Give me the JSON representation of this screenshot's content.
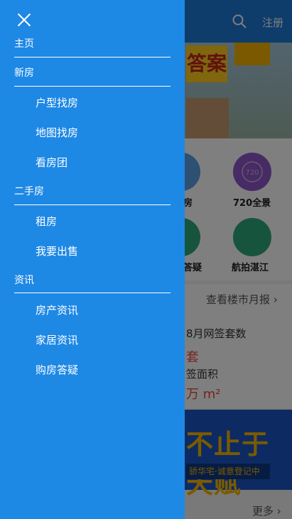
{
  "header": {
    "register_label": "注册",
    "search_icon": "search-icon"
  },
  "banner": {
    "sign_text": "答案"
  },
  "grid": {
    "items": [
      {
        "label": "房"
      },
      {
        "label": "720全景",
        "icon_text": "720"
      },
      {
        "label": "答疑"
      },
      {
        "label": "航拍湛江"
      }
    ]
  },
  "market": {
    "link_label": "查看楼市月报 ›",
    "stat1_label": "8月网签套数",
    "stat1_unit": "套",
    "stat2_label": "签面积",
    "stat2_unit": "万 m²"
  },
  "ad": {
    "headline": "不止于天赋",
    "subline": "骄华宅·诚意登记中"
  },
  "more_label": "更多 ›",
  "drawer": {
    "close_icon": "close-icon",
    "sections": [
      {
        "title": "主页",
        "items": []
      },
      {
        "title": "新房",
        "items": [
          "户型找房",
          "地图找房",
          "看房团"
        ]
      },
      {
        "title": "二手房",
        "items": [
          "租房",
          "我要出售"
        ]
      },
      {
        "title": "资讯",
        "items": [
          "房产资讯",
          "家居资讯",
          "购房答疑"
        ]
      }
    ]
  },
  "colors": {
    "drawer_bg": "#1e88e5",
    "header_bg": "#1f7ad6",
    "accent_red": "#e74b3c"
  }
}
